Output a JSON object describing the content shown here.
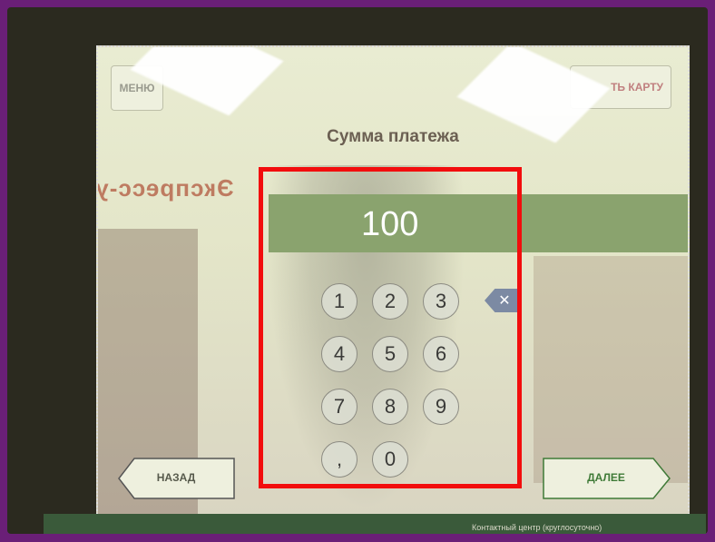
{
  "screen": {
    "menu_label": "МЕНЮ",
    "card_label": "ТЬ КАРТУ",
    "title": "Сумма платежа",
    "background_sign": "Экспресс-услуги",
    "amount": "100",
    "keys": [
      "1",
      "2",
      "3",
      "4",
      "5",
      "6",
      "7",
      "8",
      "9",
      ",",
      "0"
    ],
    "back_label": "НАЗАД",
    "next_label": "ДАЛЕЕ",
    "bottom_text": "Контактный центр (круглосуточно)"
  },
  "colors": {
    "accent_green": "#8aa36e",
    "highlight_red": "#f20d0d",
    "frame_purple": "#6a1f77"
  },
  "icons": {
    "backspace": "backspace-icon"
  }
}
